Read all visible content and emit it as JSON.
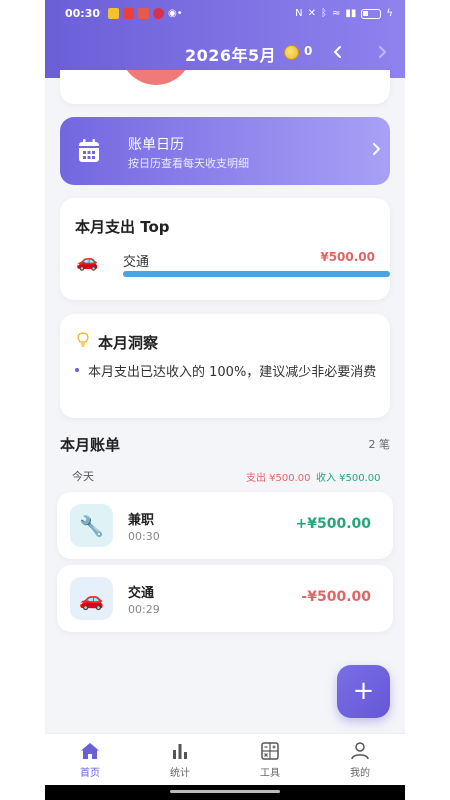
{
  "status_bar": {
    "time": "00:30"
  },
  "header": {
    "month": "2026年5月",
    "coin_count": "0",
    "prev_icon": "chevron-left-icon",
    "next_icon": "chevron-right-icon"
  },
  "calendar_card": {
    "title": "账单日历",
    "subtitle": "按日历查看每天收支明细",
    "icon": "calendar-icon"
  },
  "top_expense": {
    "title": "本月支出 Top",
    "items": [
      {
        "icon": "car-icon",
        "name": "交通",
        "amount": "¥500.00",
        "fraction": 1.0,
        "color": "#4aa3e3"
      }
    ]
  },
  "insight": {
    "title": "本月洞察",
    "items": [
      "本月支出已达收入的 100%，建议减少非必要消费"
    ]
  },
  "bills": {
    "title": "本月账单",
    "count": "2 笔",
    "groups": [
      {
        "day": "今天",
        "expense": "支出 ¥500.00",
        "income": "收入 ¥500.00",
        "items": [
          {
            "icon": "wrench-icon",
            "name": "兼职",
            "time": "00:30",
            "amount": "+¥500.00",
            "type": "income"
          },
          {
            "icon": "car-icon",
            "name": "交通",
            "time": "00:29",
            "amount": "-¥500.00",
            "type": "expense"
          }
        ]
      }
    ]
  },
  "fab": {
    "label": "+"
  },
  "tabs": [
    {
      "label": "首页",
      "icon": "home-icon",
      "active": true
    },
    {
      "label": "统计",
      "icon": "bar-chart-icon",
      "active": false
    },
    {
      "label": "工具",
      "icon": "calculator-icon",
      "active": false
    },
    {
      "label": "我的",
      "icon": "user-icon",
      "active": false
    }
  ],
  "colors": {
    "accent": "#6b5fd8",
    "income": "#26a67a",
    "expense": "#e06666"
  }
}
